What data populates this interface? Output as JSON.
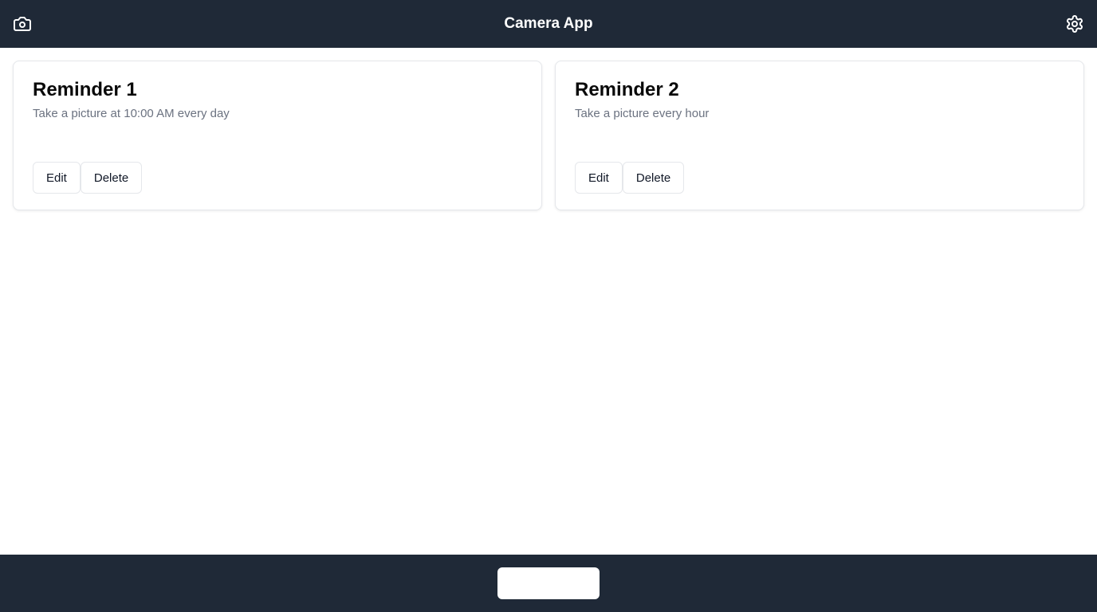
{
  "header": {
    "title": "Camera App",
    "left_icon": "camera-icon",
    "right_icon": "gear-icon"
  },
  "reminders": [
    {
      "title": "Reminder 1",
      "description": "Take a picture at 10:00 AM every day",
      "edit_label": "Edit",
      "delete_label": "Delete"
    },
    {
      "title": "Reminder 2",
      "description": "Take a picture every hour",
      "edit_label": "Edit",
      "delete_label": "Delete"
    }
  ],
  "footer": {
    "capture_label": ""
  },
  "colors": {
    "bar_background": "#1f2937",
    "card_border": "#e5e7eb",
    "muted_text": "#6b7280"
  }
}
